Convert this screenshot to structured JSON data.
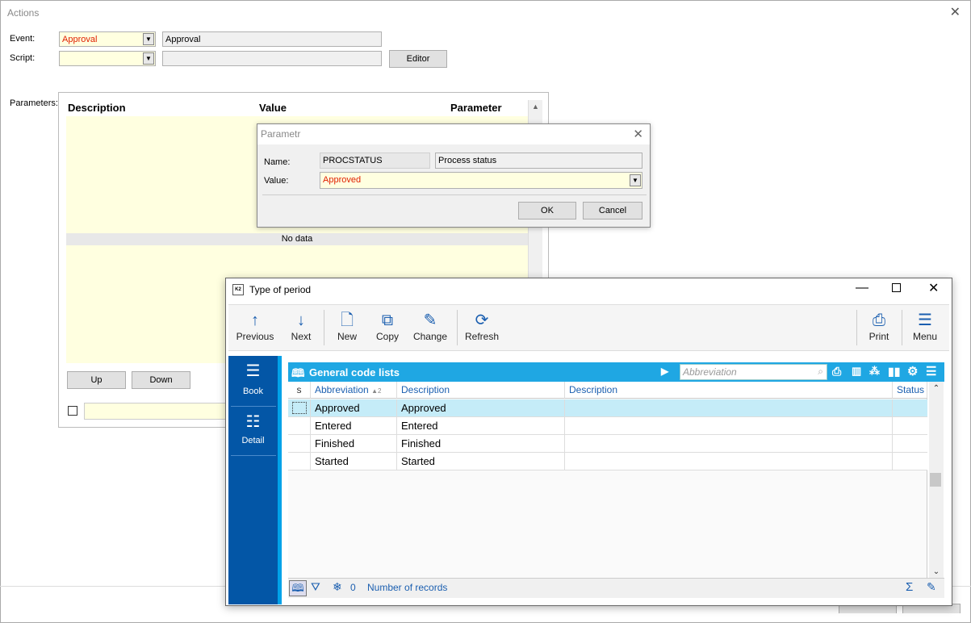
{
  "main": {
    "title": "Actions",
    "close": "✕",
    "event_label": "Event:",
    "event_value": "Approval",
    "event_desc": "Approval",
    "script_label": "Script:",
    "script_value": "",
    "editor_btn": "Editor",
    "parameters_label": "Parameters:",
    "grid_headers": [
      "Description",
      "Value",
      "Parameter"
    ],
    "no_data": "No data",
    "up_btn": "Up",
    "down_btn": "Down"
  },
  "dialog": {
    "title": "Parametr",
    "close": "✕",
    "name_label": "Name:",
    "name_value": "PROCSTATUS",
    "name_desc": "Process status",
    "value_label": "Value:",
    "value_value": "Approved",
    "ok": "OK",
    "cancel": "Cancel"
  },
  "period": {
    "logo": "K2",
    "title": "Type of period",
    "toolbar": [
      {
        "label": "Previous",
        "icon": "arrow-up-icon",
        "glyph": "↑"
      },
      {
        "label": "Next",
        "icon": "arrow-down-icon",
        "glyph": "↓"
      },
      {
        "label": "New",
        "icon": "new-document-icon",
        "glyph": "🗋"
      },
      {
        "label": "Copy",
        "icon": "copy-icon",
        "glyph": "⧉"
      },
      {
        "label": "Change",
        "icon": "pencil-icon",
        "glyph": "✎"
      },
      {
        "label": "Refresh",
        "icon": "refresh-icon",
        "glyph": "⟳"
      },
      {
        "label": "Print",
        "icon": "printer-icon",
        "glyph": "⎙"
      },
      {
        "label": "Menu",
        "icon": "menu-icon",
        "glyph": "☰"
      }
    ],
    "side": [
      {
        "label": "Book",
        "icon": "list-icon"
      },
      {
        "label": "Detail",
        "icon": "detail-list-icon"
      }
    ],
    "grid_title": "General code lists",
    "search_placeholder": "Abbreviation",
    "columns": [
      "s",
      "Abbreviation",
      "Description",
      "Description",
      "Status"
    ],
    "sort_marker": "▲2",
    "rows": [
      {
        "abbreviation": "Approved",
        "description": "Approved"
      },
      {
        "abbreviation": "Entered",
        "description": "Entered"
      },
      {
        "abbreviation": "Finished",
        "description": "Finished"
      },
      {
        "abbreviation": "Started",
        "description": "Started"
      }
    ],
    "footer_count": "0",
    "footer_label": "Number of records",
    "accent": "#1fa7e3",
    "side_color": "#0356a6"
  }
}
